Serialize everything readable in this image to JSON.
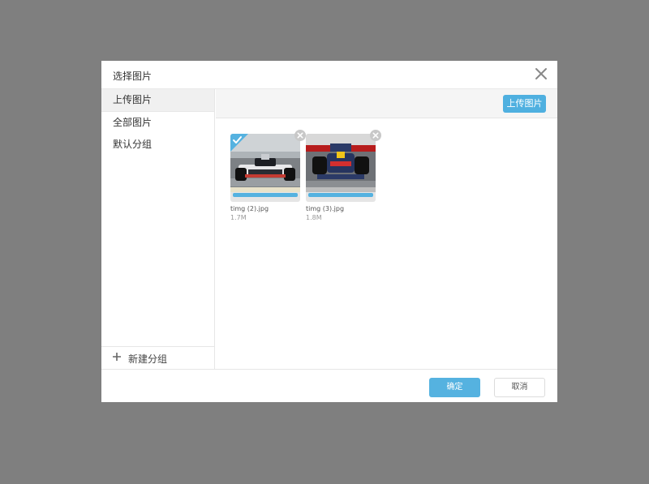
{
  "dialog": {
    "title": "选择图片",
    "close_icon": "close-icon"
  },
  "sidebar": {
    "items": [
      {
        "label": "上传图片",
        "active": true
      },
      {
        "label": "全部图片",
        "active": false
      },
      {
        "label": "默认分组",
        "active": false
      }
    ],
    "new_group_label": "新建分组",
    "new_group_icon": "plus-icon"
  },
  "toolbar": {
    "upload_label": "上传图片"
  },
  "images": [
    {
      "name": "timg (2).jpg",
      "size": "1.7M",
      "selected": true,
      "progress": 1.0,
      "thumb_icon": "f1-car-image"
    },
    {
      "name": "timg (3).jpg",
      "size": "1.8M",
      "selected": false,
      "progress": 1.0,
      "thumb_icon": "f1-car-image"
    }
  ],
  "footer": {
    "ok_label": "确定",
    "cancel_label": "取消"
  },
  "colors": {
    "overlay": "#7f7f7f",
    "accent": "#55b2e0",
    "sidebar_active": "#f0f0f0"
  }
}
